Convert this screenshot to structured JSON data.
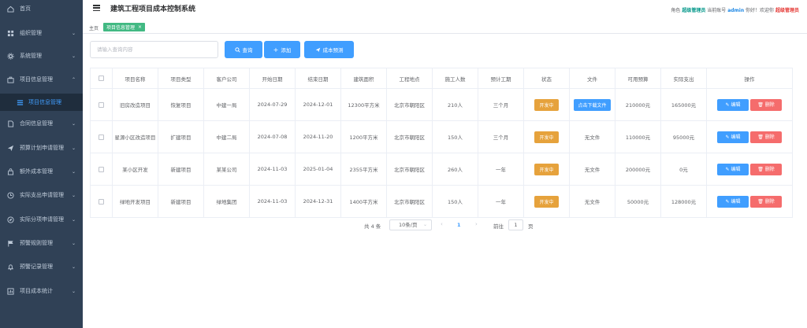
{
  "sidebar": {
    "items": [
      {
        "label": "首页",
        "icon": "home-icon",
        "arrow": ""
      },
      {
        "label": "组织管理",
        "icon": "grid-icon",
        "arrow": "⌄"
      },
      {
        "label": "系统管理",
        "icon": "gear-icon",
        "arrow": "⌄"
      },
      {
        "label": "项目信息管理",
        "icon": "briefcase-icon",
        "arrow": "⌃"
      },
      {
        "label": "项目信息管理",
        "icon": "list-icon",
        "arrow": ""
      },
      {
        "label": "合同信息管理",
        "icon": "document-icon",
        "arrow": "⌄"
      },
      {
        "label": "预算计划申请管理",
        "icon": "send-icon",
        "arrow": "⌄"
      },
      {
        "label": "额外成本管理",
        "icon": "bag-icon",
        "arrow": "⌄"
      },
      {
        "label": "实际支出申请管理",
        "icon": "clock-icon",
        "arrow": "⌄"
      },
      {
        "label": "实际分项申请管理",
        "icon": "compass-icon",
        "arrow": "⌄"
      },
      {
        "label": "预警规则管理",
        "icon": "flag-icon",
        "arrow": "⌄"
      },
      {
        "label": "预警记录管理",
        "icon": "bell-icon",
        "arrow": "⌄"
      },
      {
        "label": "项目成本统计",
        "icon": "chart-icon",
        "arrow": "⌄"
      }
    ]
  },
  "header": {
    "title": "建筑工程项目成本控制系统",
    "role_prefix": "角色",
    "role": "超级管理员",
    "account_prefix": "当前账号",
    "account": "admin",
    "greeting": "你好！欢迎你",
    "user": "超级管理员"
  },
  "tags": {
    "home": "主页",
    "active": "项目信息管理",
    "close": "×"
  },
  "toolbar": {
    "search_placeholder": "请输入查询内容",
    "query_label": "查询",
    "add_label": "添加",
    "forecast_label": "成本预测"
  },
  "table": {
    "headers": [
      "",
      "项目名称",
      "项目类型",
      "客户公司",
      "开始日期",
      "结束日期",
      "建筑面积",
      "工程地点",
      "施工人数",
      "预计工期",
      "状态",
      "文件",
      "可用预算",
      "实际支出",
      "操作"
    ],
    "rows": [
      {
        "name": "旧房改造项目",
        "type": "恢复项目",
        "client": "中建一局",
        "start": "2024-07-29",
        "end": "2024-12-01",
        "area": "12300平方米",
        "location": "北京市朝阳区",
        "workers": "210人",
        "duration": "三个月",
        "status": "开发中",
        "file": "点击下载文件",
        "file_is_button": true,
        "budget": "210000元",
        "actual": "165000元"
      },
      {
        "name": "星源小区改造项目",
        "type": "扩建项目",
        "client": "中建二局",
        "start": "2024-07-08",
        "end": "2024-11-20",
        "area": "1200平方米",
        "location": "北京市朝阳区",
        "workers": "150人",
        "duration": "三个月",
        "status": "开发中",
        "file": "无文件",
        "file_is_button": false,
        "budget": "110000元",
        "actual": "95000元"
      },
      {
        "name": "某小区开发",
        "type": "新建项目",
        "client": "某某公司",
        "start": "2024-11-03",
        "end": "2025-01-04",
        "area": "2355平方米",
        "location": "北京市朝阳区",
        "workers": "260人",
        "duration": "一年",
        "status": "开发中",
        "file": "无文件",
        "file_is_button": false,
        "budget": "200000元",
        "actual": "0元"
      },
      {
        "name": "绿地开发项目",
        "type": "新建项目",
        "client": "绿地集团",
        "start": "2024-11-03",
        "end": "2024-12-31",
        "area": "1400平方米",
        "location": "北京市朝阳区",
        "workers": "150人",
        "duration": "一年",
        "status": "开发中",
        "file": "无文件",
        "file_is_button": false,
        "budget": "50000元",
        "actual": "128000元"
      }
    ],
    "edit_label": "编辑",
    "delete_label": "删除"
  },
  "pagination": {
    "total": "共 4 条",
    "page_size": "10条/页",
    "current_page": "1",
    "goto_label": "前往",
    "goto_value": "1",
    "page_suffix": "页"
  },
  "colors": {
    "sidebar_bg": "#304156",
    "primary": "#409eff",
    "danger": "#f56c6c",
    "warning": "#e6a23c",
    "tag": "#42b983"
  }
}
